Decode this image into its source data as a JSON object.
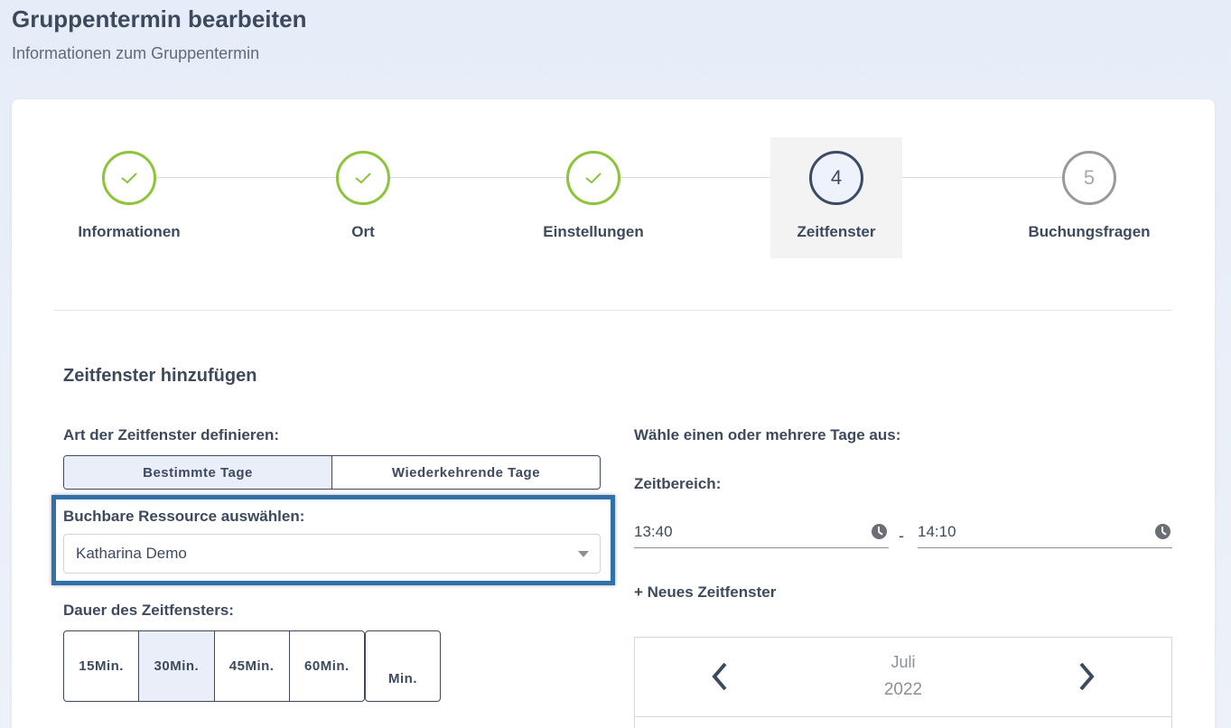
{
  "header": {
    "title": "Gruppentermin bearbeiten",
    "subtitle": "Informationen zum Gruppentermin"
  },
  "stepper": {
    "steps": [
      {
        "label": "Informationen",
        "state": "done",
        "icon": "check-icon"
      },
      {
        "label": "Ort",
        "state": "done",
        "icon": "check-icon"
      },
      {
        "label": "Einstellungen",
        "state": "done",
        "icon": "check-icon"
      },
      {
        "label": "Zeitfenster",
        "number": "4",
        "state": "current"
      },
      {
        "label": "Buchungsfragen",
        "number": "5",
        "state": "pending"
      }
    ]
  },
  "form": {
    "section_title": "Zeitfenster hinzufügen",
    "type_label": "Art der Zeitfenster definieren:",
    "type_options": [
      "Bestimmte Tage",
      "Wiederkehrende Tage"
    ],
    "type_selected": "Bestimmte Tage",
    "resource_label": "Buchbare Ressource auswählen:",
    "resource_value": "Katharina Demo",
    "duration_label": "Dauer des Zeitfensters:",
    "duration_options": [
      "15Min.",
      "30Min.",
      "45Min.",
      "60Min."
    ],
    "duration_selected": "30Min.",
    "custom_duration_unit": "Min."
  },
  "schedule": {
    "days_label": "Wähle einen oder mehrere Tage aus:",
    "time_range_label": "Zeitbereich:",
    "time_from": "13:40",
    "time_separator": "-",
    "time_to": "14:10",
    "new_slot_label": "+ Neues Zeitfenster"
  },
  "calendar": {
    "month": "Juli",
    "year": "2022"
  },
  "colors": {
    "done": "#8cc43a",
    "current": "#3b4a66",
    "pending": "#9a9a9a",
    "highlight": "#3170a8"
  }
}
